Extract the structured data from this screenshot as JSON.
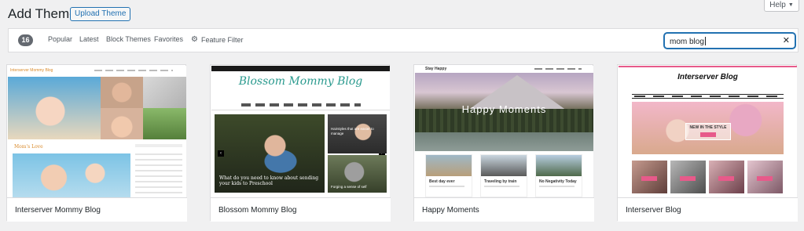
{
  "header": {
    "title": "Add Themes",
    "upload_label": "Upload Theme",
    "help_label": "Help"
  },
  "filter": {
    "count": "16",
    "tabs": {
      "popular": "Popular",
      "latest": "Latest",
      "block": "Block Themes",
      "favorites": "Favorites",
      "feature": "Feature Filter"
    },
    "search_value": "mom blog"
  },
  "themes": [
    {
      "name": "Interserver Mommy Blog",
      "preview": {
        "logo": "Interserver Mommy Blog",
        "section": "Mom's Love"
      }
    },
    {
      "name": "Blossom Mommy Blog",
      "preview": {
        "title": "Blossom Mommy Blog",
        "main_caption": "What do you need to know about sending your kids to Preschool",
        "side_caption_1": "Hairstyles that are easier to manage",
        "side_caption_2": "Forging a sense of self"
      }
    },
    {
      "name": "Happy Moments",
      "preview": {
        "logo": "Stay Happy",
        "hero_title": "Happy Moments",
        "card_1": "Best day ever",
        "card_2": "Traveling by train",
        "card_3": "No Negativity Today"
      }
    },
    {
      "name": "Interserver Blog",
      "preview": {
        "title": "Interserver Blog",
        "hero_text": "NEW IN THE STYLE"
      }
    }
  ],
  "colors": {
    "accent": "#2271b1",
    "badge": "#646970",
    "pink": "#e75a8a"
  }
}
